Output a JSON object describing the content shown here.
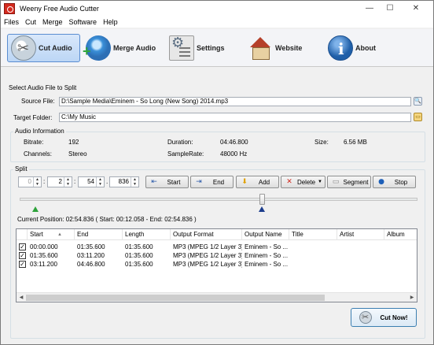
{
  "window": {
    "title": "Weeny Free Audio Cutter"
  },
  "window_controls": {
    "minimize": "—",
    "maximize": "☐",
    "close": "✕"
  },
  "menu": [
    "Files",
    "Cut",
    "Merge",
    "Software",
    "Help"
  ],
  "toolbar": {
    "cut_audio": "Cut Audio",
    "merge_audio": "Merge Audio",
    "settings": "Settings",
    "website": "Website",
    "about": "About"
  },
  "select_section": {
    "heading": "Select Audio File to Split",
    "source_label": "Source File:",
    "source_value": "D:\\Sample Media\\Eminem - So Long (New Song) 2014.mp3",
    "target_label": "Target Folder:",
    "target_value": "C:\\My Music"
  },
  "audio_info": {
    "group_label": "Audio Information",
    "bitrate_label": "Bitrate:",
    "bitrate_value": "192",
    "channels_label": "Channels:",
    "channels_value": "Stereo",
    "duration_label": "Duration:",
    "duration_value": "04:46.800",
    "samplerate_label": "SampleRate:",
    "samplerate_value": "48000 Hz",
    "size_label": "Size:",
    "size_value": "6.56 MB"
  },
  "split": {
    "group_label": "Split",
    "hours": "0",
    "minutes": "2",
    "seconds": "54",
    "milliseconds": "836",
    "sep1": ":",
    "sep2": ":",
    "sep3": ".",
    "buttons": {
      "start": "Start",
      "end": "End",
      "add": "Add",
      "delete": "Delete",
      "segment": "Segment",
      "stop": "Stop"
    },
    "slider_position": 0.608,
    "current_position": "Current Position: 02:54.836 ( Start: 00:12.058 - End: 02:54.836 )"
  },
  "segments": {
    "columns": [
      "Start",
      "End",
      "Length",
      "Output Format",
      "Output Name",
      "Title",
      "Artist",
      "Album"
    ],
    "rows": [
      {
        "checked": "✓",
        "start": "00:00.000",
        "end": "01:35.600",
        "length": "01:35.600",
        "format": "MP3 (MPEG 1/2 Layer 3)",
        "name": "Eminem - So ..."
      },
      {
        "checked": "✓",
        "start": "01:35.600",
        "end": "03:11.200",
        "length": "01:35.600",
        "format": "MP3 (MPEG 1/2 Layer 3)",
        "name": "Eminem - So ..."
      },
      {
        "checked": "✓",
        "start": "03:11.200",
        "end": "04:46.800",
        "length": "01:35.600",
        "format": "MP3 (MPEG 1/2 Layer 3)",
        "name": "Eminem - So ..."
      }
    ]
  },
  "cut_now": "Cut Now!"
}
